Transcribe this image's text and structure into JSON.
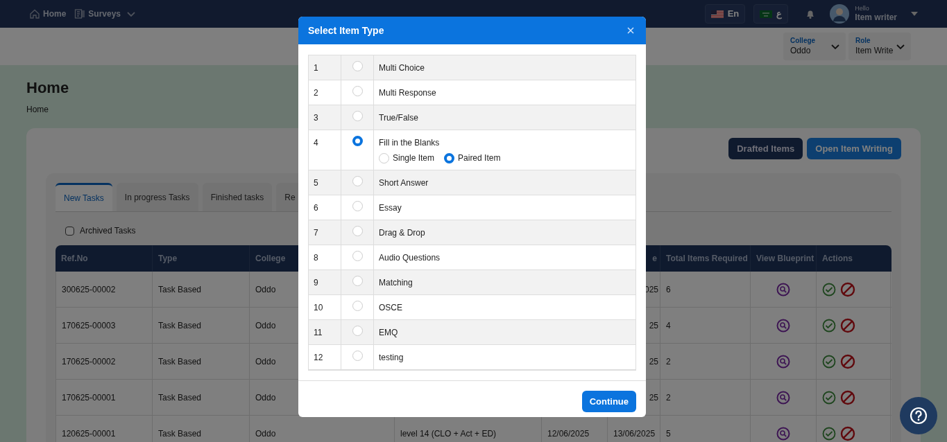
{
  "nav_links": [
    {
      "label": "Home",
      "dropdown": false
    },
    {
      "label": "Surveys",
      "dropdown": true
    }
  ],
  "languages": [
    {
      "label": "En"
    },
    {
      "label": "ع"
    }
  ],
  "user": {
    "greeting": "Hello",
    "name": "Item writer"
  },
  "selectors": [
    {
      "label": "College",
      "value": "Oddo"
    },
    {
      "label": "Role",
      "value": "Item Write"
    }
  ],
  "page_title": "Home",
  "breadcrumb": "Home",
  "actions": [
    {
      "label": "Drafted Items",
      "kind": "dark"
    },
    {
      "label": "Open Item Writing",
      "kind": "primary"
    }
  ],
  "tabs": [
    {
      "label": "New Tasks",
      "selected": true
    },
    {
      "label": "In progress Tasks",
      "selected": false
    },
    {
      "label": "Finished tasks",
      "selected": false
    },
    {
      "label": "Re",
      "selected": false
    }
  ],
  "archived": {
    "label": "Archived Tasks",
    "checked": false
  },
  "table": {
    "columns": {
      "ref": "Ref.No",
      "type": "Type",
      "college": "College",
      "end": "e",
      "total": "Total Items Required",
      "blueprint": "View Blueprint",
      "actions": "Actions"
    },
    "rows": [
      {
        "ref": "300625-00002",
        "type": "Task Based",
        "college": "Oddo",
        "end": "025",
        "total": "6"
      },
      {
        "ref": "170625-00003",
        "type": "Task Based",
        "college": "Oddo",
        "end": "25",
        "total": "4"
      },
      {
        "ref": "170625-00002",
        "type": "Task Based",
        "college": "Oddo",
        "end": "25",
        "total": "2"
      },
      {
        "ref": "170625-00001",
        "type": "Task Based",
        "college": "Oddo",
        "end": "25",
        "total": "2"
      },
      {
        "ref": "120625-00001",
        "type": "Task Based",
        "college": "Oddo",
        "title": "level 14 (CLO + Act + ED)",
        "start": "12/06/2025",
        "end": "13/06/2025",
        "total": "5"
      }
    ]
  },
  "modal": {
    "title": "Select Item Type",
    "button": "Continue",
    "options": [
      {
        "number": "1",
        "label": "Multi Choice",
        "selected": false
      },
      {
        "number": "2",
        "label": "Multi Response",
        "selected": false
      },
      {
        "number": "3",
        "label": "True/False",
        "selected": false
      },
      {
        "number": "4",
        "label": "Fill in the Blanks",
        "selected": true,
        "sub_options": [
          {
            "label": "Single Item",
            "selected": false
          },
          {
            "label": "Paired Item",
            "selected": true
          }
        ]
      },
      {
        "number": "5",
        "label": "Short Answer",
        "selected": false
      },
      {
        "number": "6",
        "label": "Essay",
        "selected": false
      },
      {
        "number": "7",
        "label": "Drag & Drop",
        "selected": false
      },
      {
        "number": "8",
        "label": "Audio Questions",
        "selected": false
      },
      {
        "number": "9",
        "label": "Matching",
        "selected": false
      },
      {
        "number": "10",
        "label": "OSCE",
        "selected": false
      },
      {
        "number": "11",
        "label": "EMQ",
        "selected": false
      },
      {
        "number": "12",
        "label": "testing",
        "selected": false
      }
    ]
  }
}
